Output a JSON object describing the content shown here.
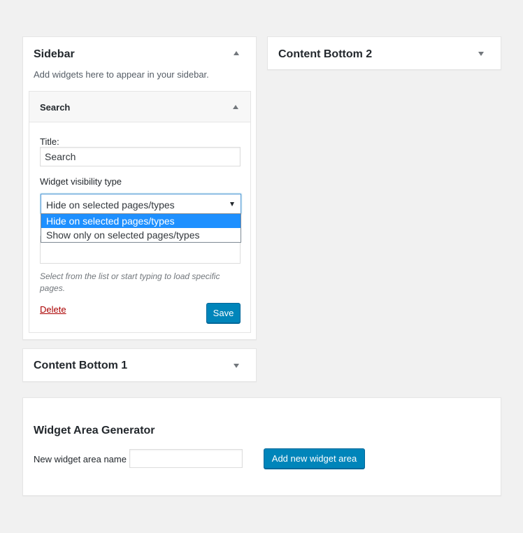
{
  "sidebar": {
    "title": "Sidebar",
    "description": "Add widgets here to appear in your sidebar.",
    "widget": {
      "title": "Search",
      "title_label": "Title:",
      "title_value": "Search",
      "visibility_label": "Widget visibility type",
      "visibility_selected": "Hide on selected pages/types",
      "visibility_options": [
        "Hide on selected pages/types",
        "Show only on selected pages/types"
      ],
      "hint": "Select from the list or start typing to load specific pages.",
      "delete_label": "Delete",
      "save_label": "Save"
    }
  },
  "content_bottom_2": {
    "title": "Content Bottom 2"
  },
  "content_bottom_1": {
    "title": "Content Bottom 1"
  },
  "generator": {
    "title": "Widget Area Generator",
    "name_label": "New widget area name",
    "name_value": "",
    "add_label": "Add new widget area"
  },
  "colors": {
    "background": "#f1f1f1",
    "primary_button": "#0085ba",
    "selected_option": "#1e90ff",
    "delete_link": "#aa0000"
  }
}
